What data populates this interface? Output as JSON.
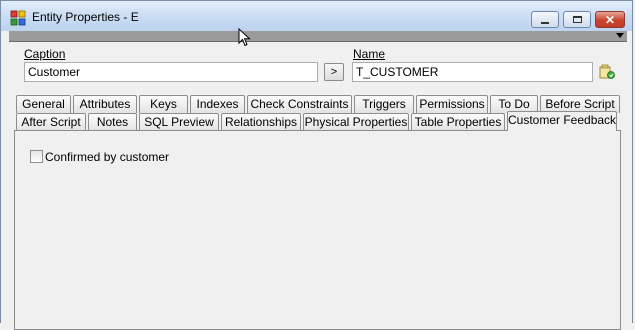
{
  "window": {
    "title": "Entity Properties - E",
    "controls": {
      "minimize": "minimize",
      "maximize": "maximize",
      "close": "✕"
    }
  },
  "form": {
    "caption_label": "Caption",
    "caption_value": "Customer",
    "copy_button": ">",
    "name_label": "Name",
    "name_value": "T_CUSTOMER"
  },
  "tabs_row1": [
    "General",
    "Attributes",
    "Keys",
    "Indexes",
    "Check Constraints",
    "Triggers",
    "Permissions",
    "To Do",
    "Before Script"
  ],
  "tabs_row2": [
    "After Script",
    "Notes",
    "SQL Preview",
    "Relationships",
    "Physical Properties",
    "Table Properties",
    "Customer Feedback"
  ],
  "active_tab": "Customer Feedback",
  "panel": {
    "checkbox_label": "Confirmed by customer",
    "checkbox_checked": false
  },
  "colors": {
    "titlebar": "#c9dcf3",
    "close_button": "#c9452f",
    "toolbar_strip": "#9b9b9b"
  }
}
